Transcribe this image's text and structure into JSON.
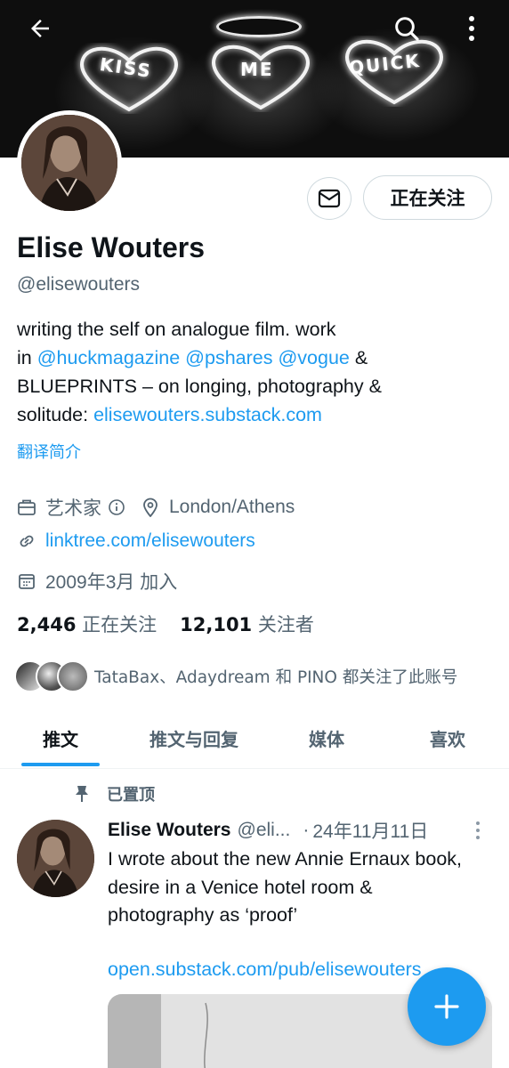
{
  "banner": {
    "hearts": [
      "KISS",
      "ME",
      "QUICK"
    ]
  },
  "topbar": {
    "back_icon": "arrow-left-icon",
    "search_icon": "search-icon",
    "more_icon": "more-vertical-icon"
  },
  "profile": {
    "name": "Elise Wouters",
    "handle": "@elisewouters",
    "follow_status_label": "正在关注",
    "message_icon": "envelope-icon",
    "bio": {
      "line1": "writing the self on analogue film. work",
      "line2_prefix": "in ",
      "mentions": [
        "@huckmagazine",
        "@pshares",
        "@vogue"
      ],
      "amp1": " &",
      "line3": "BLUEPRINTS – on longing, photography &",
      "line4_prefix": "solitude: ",
      "line4_link": "elisewouters.substack.com"
    },
    "translate_label": "翻译简介",
    "category": "艺术家",
    "location": "London/Athens",
    "website": "linktree.com/elisewouters",
    "joined": "2009年3月 加入",
    "following_count": "2,446",
    "following_label": "正在关注",
    "followers_count": "12,101",
    "followers_label": "关注者",
    "followed_by_text": "TataBax、Adaydream 和 PINO 都关注了此账号"
  },
  "tabs": [
    {
      "label": "推文",
      "active": true
    },
    {
      "label": "推文与回复",
      "active": false
    },
    {
      "label": "媒体",
      "active": false
    },
    {
      "label": "喜欢",
      "active": false
    }
  ],
  "pinned_tweet": {
    "pinned_label": "已置顶",
    "author_name": "Elise Wouters",
    "author_handle": "@eli...",
    "separator": "·",
    "date": "24年11月11日",
    "text": "I wrote about the new Annie Ernaux book, desire in a Venice hotel room & photography as ‘proof’",
    "link": "open.substack.com/pub/elisewouters"
  },
  "fab": {
    "icon": "plus-icon"
  },
  "colors": {
    "accent": "#1d9bf0",
    "text_primary": "#0f1419",
    "text_secondary": "#536471",
    "border": "#cfd9de"
  }
}
